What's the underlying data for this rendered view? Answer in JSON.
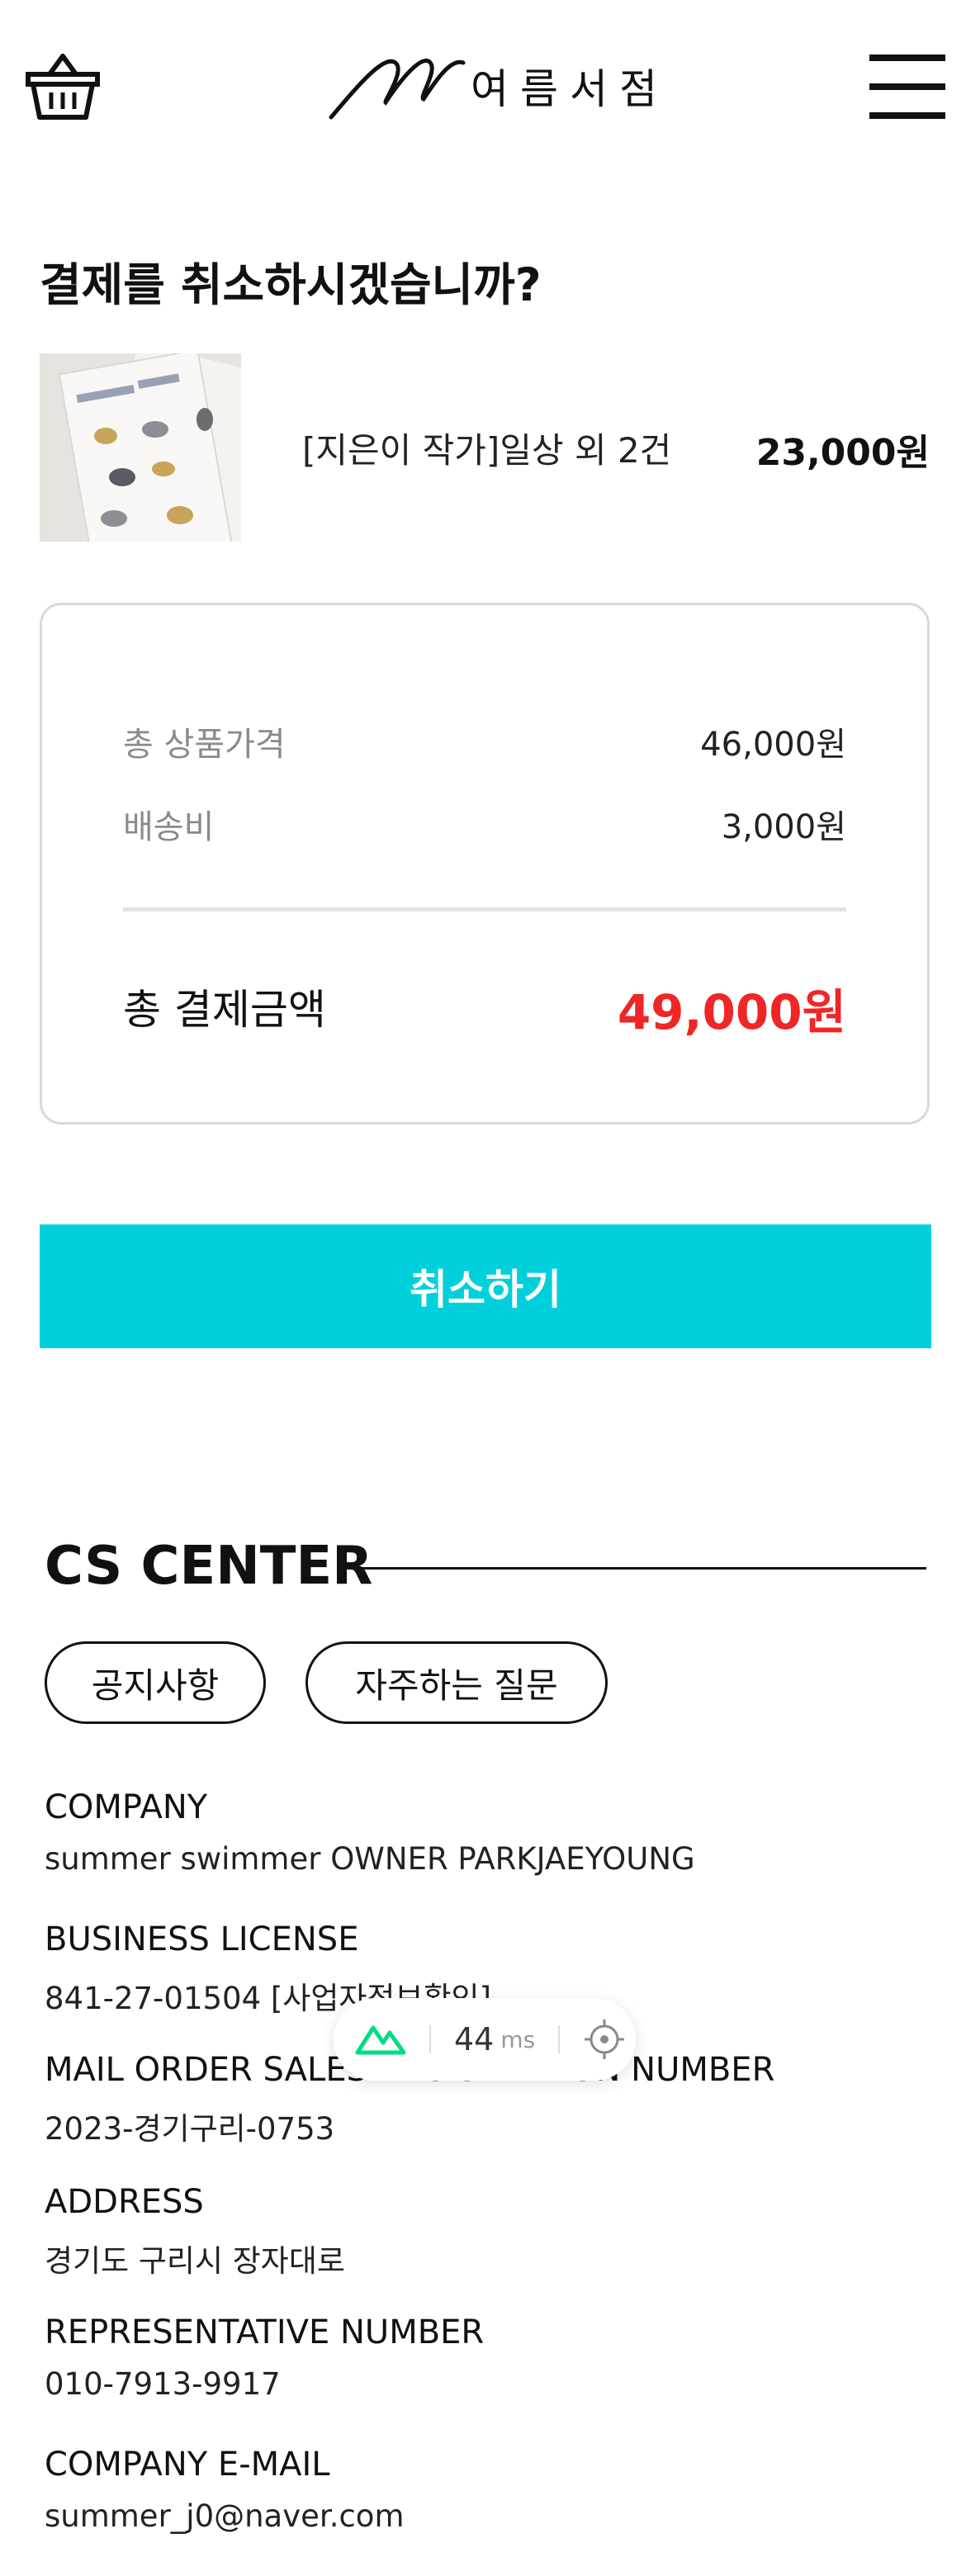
{
  "header": {
    "logo_text": "여름서점",
    "icons": {
      "cart": "basket-icon",
      "menu": "hamburger-icon"
    }
  },
  "page": {
    "title": "결제를 취소하시겠습니까?"
  },
  "product": {
    "name": "[지은이 작가]일상 외 2건",
    "price": "23,000원"
  },
  "summary": {
    "subtotal_label": "총 상품가격",
    "subtotal_value": "46,000원",
    "shipping_label": "배송비",
    "shipping_value": "3,000원",
    "total_label": "총 결제금액",
    "total_value": "49,000원",
    "total_color": "#ee2626"
  },
  "cancel_button": {
    "label": "취소하기",
    "color": "#00d0dc"
  },
  "cs_center": {
    "title": "CS CENTER",
    "buttons": [
      "공지사항",
      "자주하는 질문"
    ],
    "info": [
      {
        "label": "COMPANY",
        "value": "summer swimmer OWNER PARKJAEYOUNG"
      },
      {
        "label": "BUSINESS LICENSE",
        "value": "841-27-01504 [사업자정보확인]"
      },
      {
        "label": "MAIL ORDER SALES REGISTRATION NUMBER",
        "value": "2023-경기구리-0753"
      },
      {
        "label": "ADDRESS",
        "value": "경기도 구리시 장자대로"
      },
      {
        "label": "REPRESENTATIVE NUMBER",
        "value": "010-7913-9917"
      },
      {
        "label": "COMPANY E-MAIL",
        "value": "summer_j0@naver.com"
      }
    ]
  },
  "perf_badge": {
    "value": "44",
    "unit": "ms",
    "icons": {
      "logo": "nuxt-logo-icon",
      "target": "crosshair-icon"
    },
    "accent": "#00dc82"
  }
}
